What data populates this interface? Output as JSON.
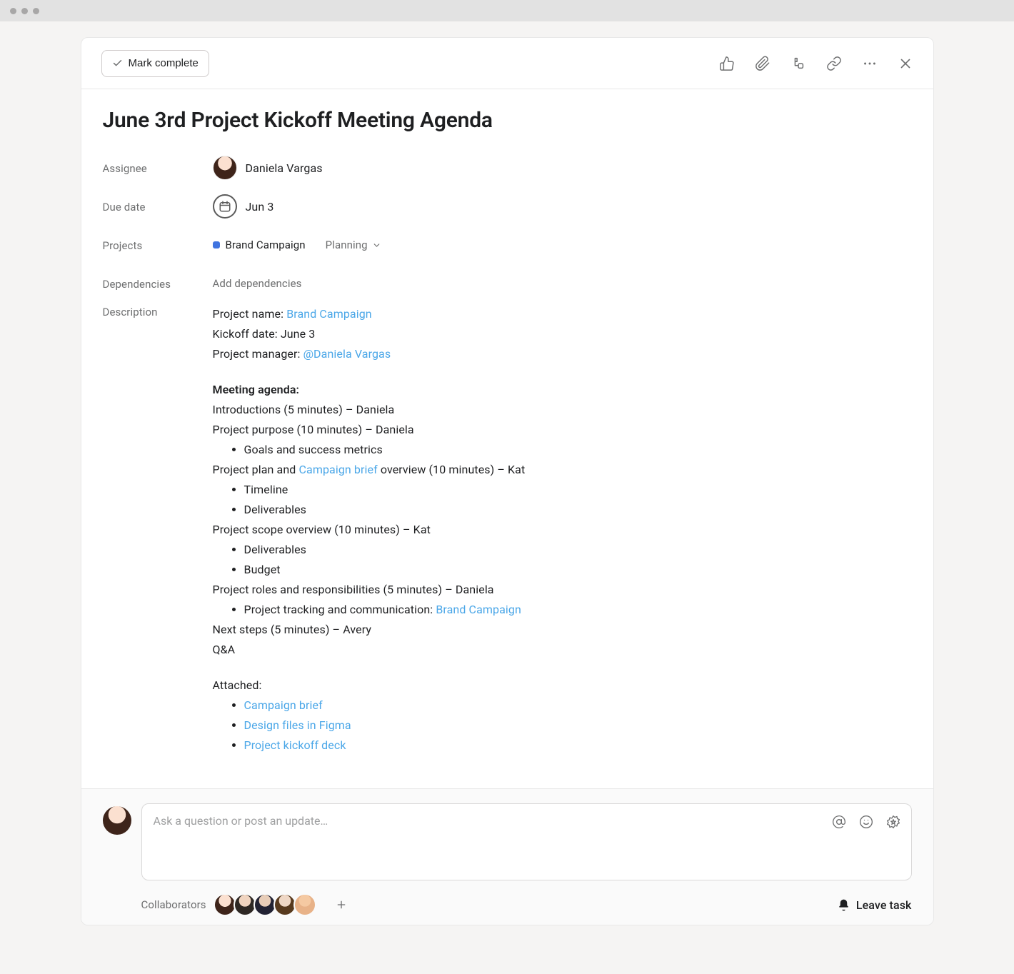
{
  "header": {
    "mark_complete_label": "Mark complete"
  },
  "task": {
    "title": "June 3rd Project Kickoff Meeting Agenda"
  },
  "fields": {
    "assignee_label": "Assignee",
    "assignee_name": "Daniela Vargas",
    "due_date_label": "Due date",
    "due_date_value": "Jun 3",
    "projects_label": "Projects",
    "project_name": "Brand Campaign",
    "project_section": "Planning",
    "dependencies_label": "Dependencies",
    "add_dependencies": "Add dependencies",
    "description_label": "Description"
  },
  "description": {
    "project_name_label": "Project name: ",
    "project_name_link": "Brand Campaign",
    "kickoff_line": "Kickoff date: June 3",
    "pm_label": "Project manager: ",
    "pm_mention": "@Daniela Vargas",
    "agenda_heading": "Meeting agenda:",
    "intro_line": "Introductions (5 minutes) – Daniela",
    "purpose_line": "Project purpose (10 minutes) – Daniela",
    "purpose_bullet1": "Goals and success metrics",
    "plan_prefix": "Project plan and ",
    "plan_link": "Campaign brief",
    "plan_suffix": " overview (10 minutes) – Kat",
    "plan_bullet1": "Timeline",
    "plan_bullet2": "Deliverables",
    "scope_line": "Project scope overview (10 minutes) – Kat",
    "scope_bullet1": "Deliverables",
    "scope_bullet2": "Budget",
    "roles_line": "Project roles and responsibilities (5 minutes) – Daniela",
    "roles_bullet_prefix": "Project tracking and communication: ",
    "roles_bullet_link": "Brand Campaign",
    "next_steps_line": "Next steps (5 minutes) – Avery",
    "qa_line": "Q&A",
    "attached_heading": "Attached:",
    "attached_1": "Campaign brief",
    "attached_2": "Design files in Figma",
    "attached_3": "Project kickoff deck"
  },
  "composer": {
    "placeholder": "Ask a question or post an update…"
  },
  "footer": {
    "collaborators_label": "Collaborators",
    "leave_task_label": "Leave task"
  }
}
